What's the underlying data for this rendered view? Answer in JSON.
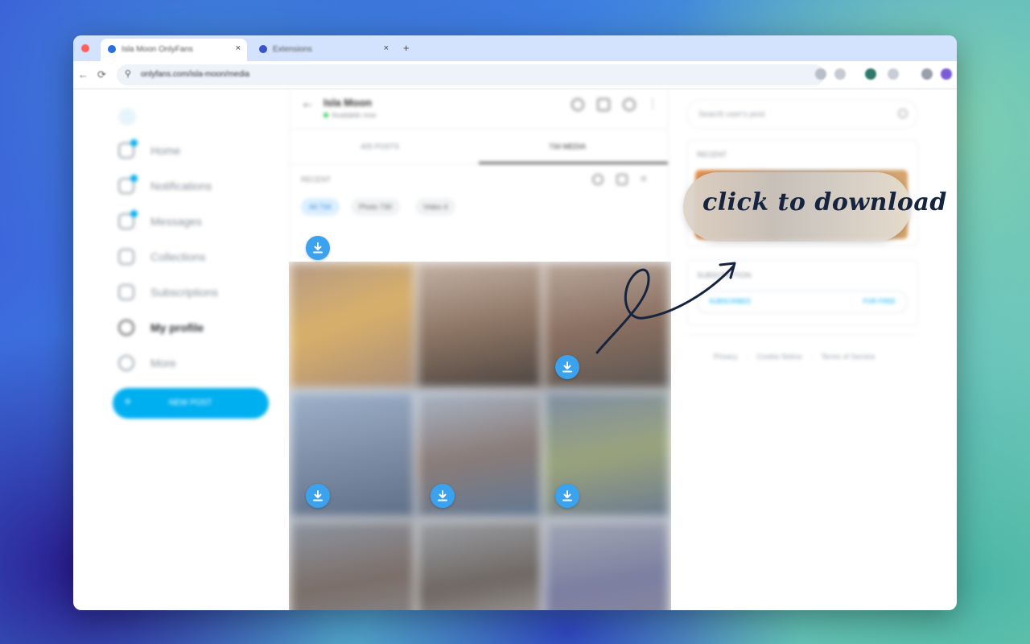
{
  "browser": {
    "tabs": [
      {
        "title": "Isla Moon OnlyFans",
        "active": true
      },
      {
        "title": "Extensions",
        "active": false
      }
    ],
    "new_tab_symbol": "+",
    "close_symbol": "×",
    "url": "onlyfans.com/isla-moon/media"
  },
  "sidebar": {
    "items": [
      {
        "label": "Home",
        "icon": "home-icon",
        "badge": true
      },
      {
        "label": "Notifications",
        "icon": "bell-icon",
        "badge": true
      },
      {
        "label": "Messages",
        "icon": "message-icon",
        "badge": true
      },
      {
        "label": "Collections",
        "icon": "bookmark-icon",
        "badge": false
      },
      {
        "label": "Subscriptions",
        "icon": "subscriptions-icon",
        "badge": false
      },
      {
        "label": "My profile",
        "icon": "profile-icon",
        "badge": false
      },
      {
        "label": "More",
        "icon": "more-icon",
        "badge": false
      }
    ],
    "new_post_label": "NEW POST"
  },
  "profile": {
    "name": "Isla Moon",
    "status": "Available now",
    "tabs": [
      "405 POSTS",
      "734 MEDIA"
    ],
    "section_label": "RECENT",
    "filters": [
      "All 734",
      "Photo 730",
      "Video 4"
    ]
  },
  "right_panel": {
    "search_placeholder": "Search user's post",
    "recent_label": "RECENT",
    "subscription_label": "SUBSCRIPTION",
    "subscribed_label": "SUBSCRIBED",
    "price_label": "FOR FREE",
    "footer_links": [
      "Privacy",
      "Cookie Notice",
      "Terms of Service"
    ]
  },
  "callout": {
    "text": "click to download"
  },
  "colors": {
    "accent": "#00aff0",
    "download_button": "#3aa2ef",
    "callout_text": "#16243f"
  }
}
